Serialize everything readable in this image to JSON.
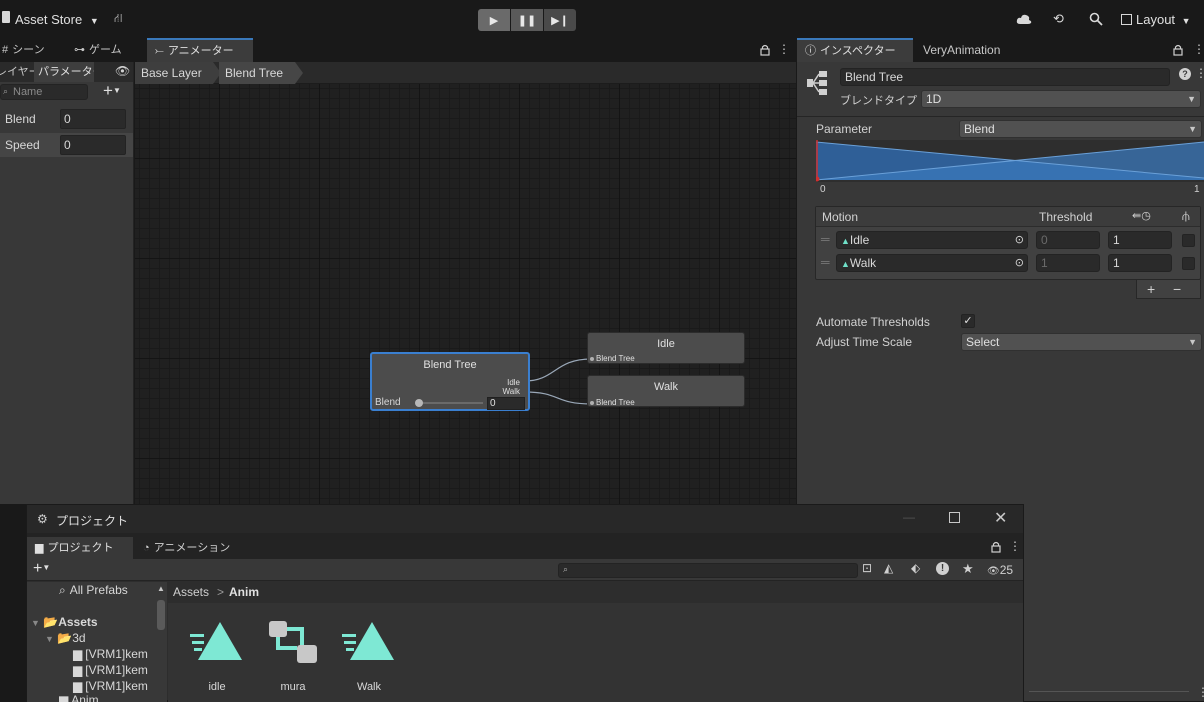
{
  "toolbar": {
    "asset_store": "Asset Store",
    "layout": "Layout"
  },
  "tabs_left": [
    {
      "label": "シーン"
    },
    {
      "label": "ゲーム"
    },
    {
      "label": "アニメーター"
    }
  ],
  "tabs_right": [
    {
      "label": "インスペクター"
    },
    {
      "label": "VeryAnimation"
    }
  ],
  "params_panel": {
    "tab_layers": "レイヤー",
    "tab_params": "パラメーター",
    "search_placeholder": "Name",
    "params": [
      {
        "name": "Blend",
        "value": "0"
      },
      {
        "name": "Speed",
        "value": "0"
      }
    ]
  },
  "breadcrumb": [
    "Base Layer",
    "Blend Tree"
  ],
  "graph": {
    "blend_tree_node": {
      "title": "Blend Tree",
      "port_idle": "Idle",
      "port_walk": "Walk",
      "param_label": "Blend",
      "param_value": "0"
    },
    "idle_node": {
      "title": "Idle",
      "port": "Blend Tree"
    },
    "walk_node": {
      "title": "Walk",
      "port": "Blend Tree"
    }
  },
  "inspector": {
    "name": "Blend Tree",
    "blend_type_label": "ブレンドタイプ",
    "blend_type_value": "1D",
    "parameter_label": "Parameter",
    "parameter_value": "Blend",
    "range_min": "0",
    "range_max": "1",
    "motion_header": "Motion",
    "threshold_header": "Threshold",
    "motions": [
      {
        "name": "Idle",
        "threshold": "0",
        "speed": "1"
      },
      {
        "name": "Walk",
        "threshold": "1",
        "speed": "1"
      }
    ],
    "automate_label": "Automate Thresholds",
    "adjust_label": "Adjust Time Scale",
    "adjust_value": "Select",
    "add_button": "+",
    "remove_button": "−"
  },
  "project": {
    "window_title": "プロジェクト",
    "tab_project": "プロジェクト",
    "tab_animation": "アニメーション",
    "hidden_count": "25",
    "all_prefabs": "All Prefabs",
    "path_root": "Assets",
    "path_sep": ">",
    "path_current": "Anim",
    "tree": [
      {
        "label": "Assets"
      },
      {
        "label": "3d"
      },
      {
        "label": "[VRM1]kem"
      },
      {
        "label": "[VRM1]kem"
      },
      {
        "label": "[VRM1]kem"
      },
      {
        "label": "Anim"
      }
    ],
    "assets": [
      {
        "label": "idle"
      },
      {
        "label": "mura"
      },
      {
        "label": "Walk"
      }
    ]
  }
}
